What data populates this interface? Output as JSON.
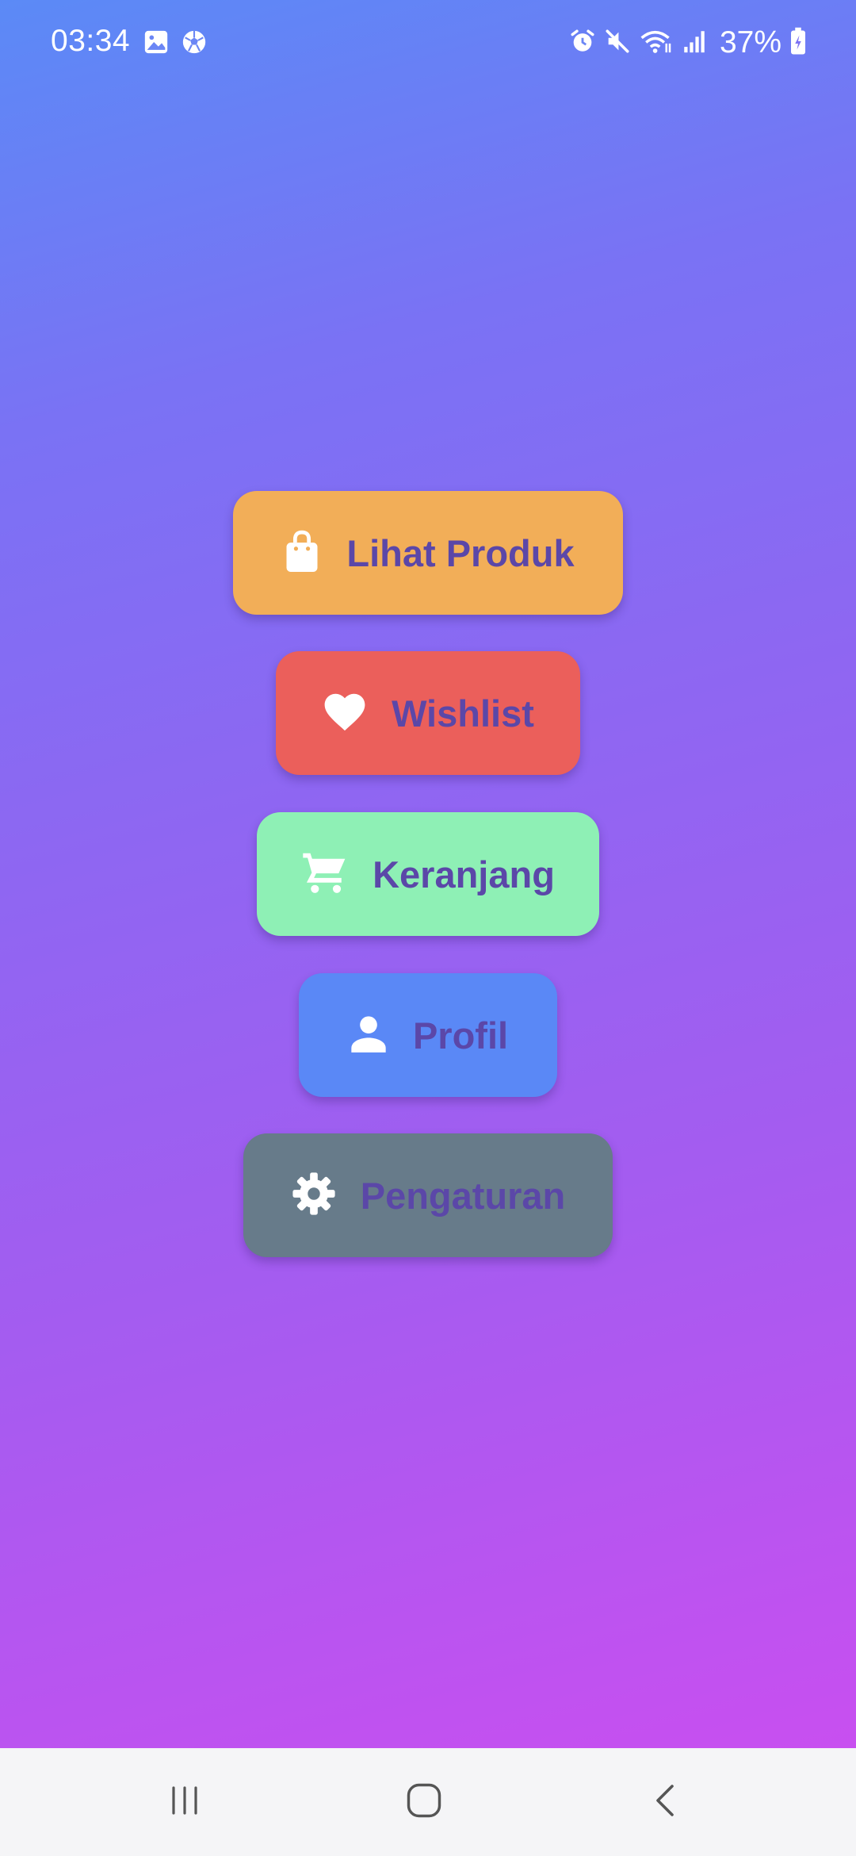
{
  "status_bar": {
    "time": "03:34",
    "battery": "37%",
    "left_icons": [
      "image-icon",
      "soccer-ball-icon"
    ],
    "right_icons": [
      "alarm-icon",
      "mute-icon",
      "wifi-icon",
      "signal-icon",
      "battery-charging-icon"
    ]
  },
  "menu": {
    "items": [
      {
        "label": "Lihat Produk",
        "icon": "shopping-bag-icon",
        "color": "#f2ae58"
      },
      {
        "label": "Wishlist",
        "icon": "heart-icon",
        "color": "#eb5f5b"
      },
      {
        "label": "Keranjang",
        "icon": "cart-icon",
        "color": "#8ef0b5"
      },
      {
        "label": "Profil",
        "icon": "person-icon",
        "color": "#5a88f6"
      },
      {
        "label": "Pengaturan",
        "icon": "gear-icon",
        "color": "#677b8a"
      }
    ],
    "label_color": "#5b47a8"
  },
  "nav_bar": {
    "buttons": [
      "recents-icon",
      "home-icon",
      "back-icon"
    ]
  },
  "theme": {
    "gradient_start": "#5b8af6",
    "gradient_end": "#c84ff0"
  }
}
